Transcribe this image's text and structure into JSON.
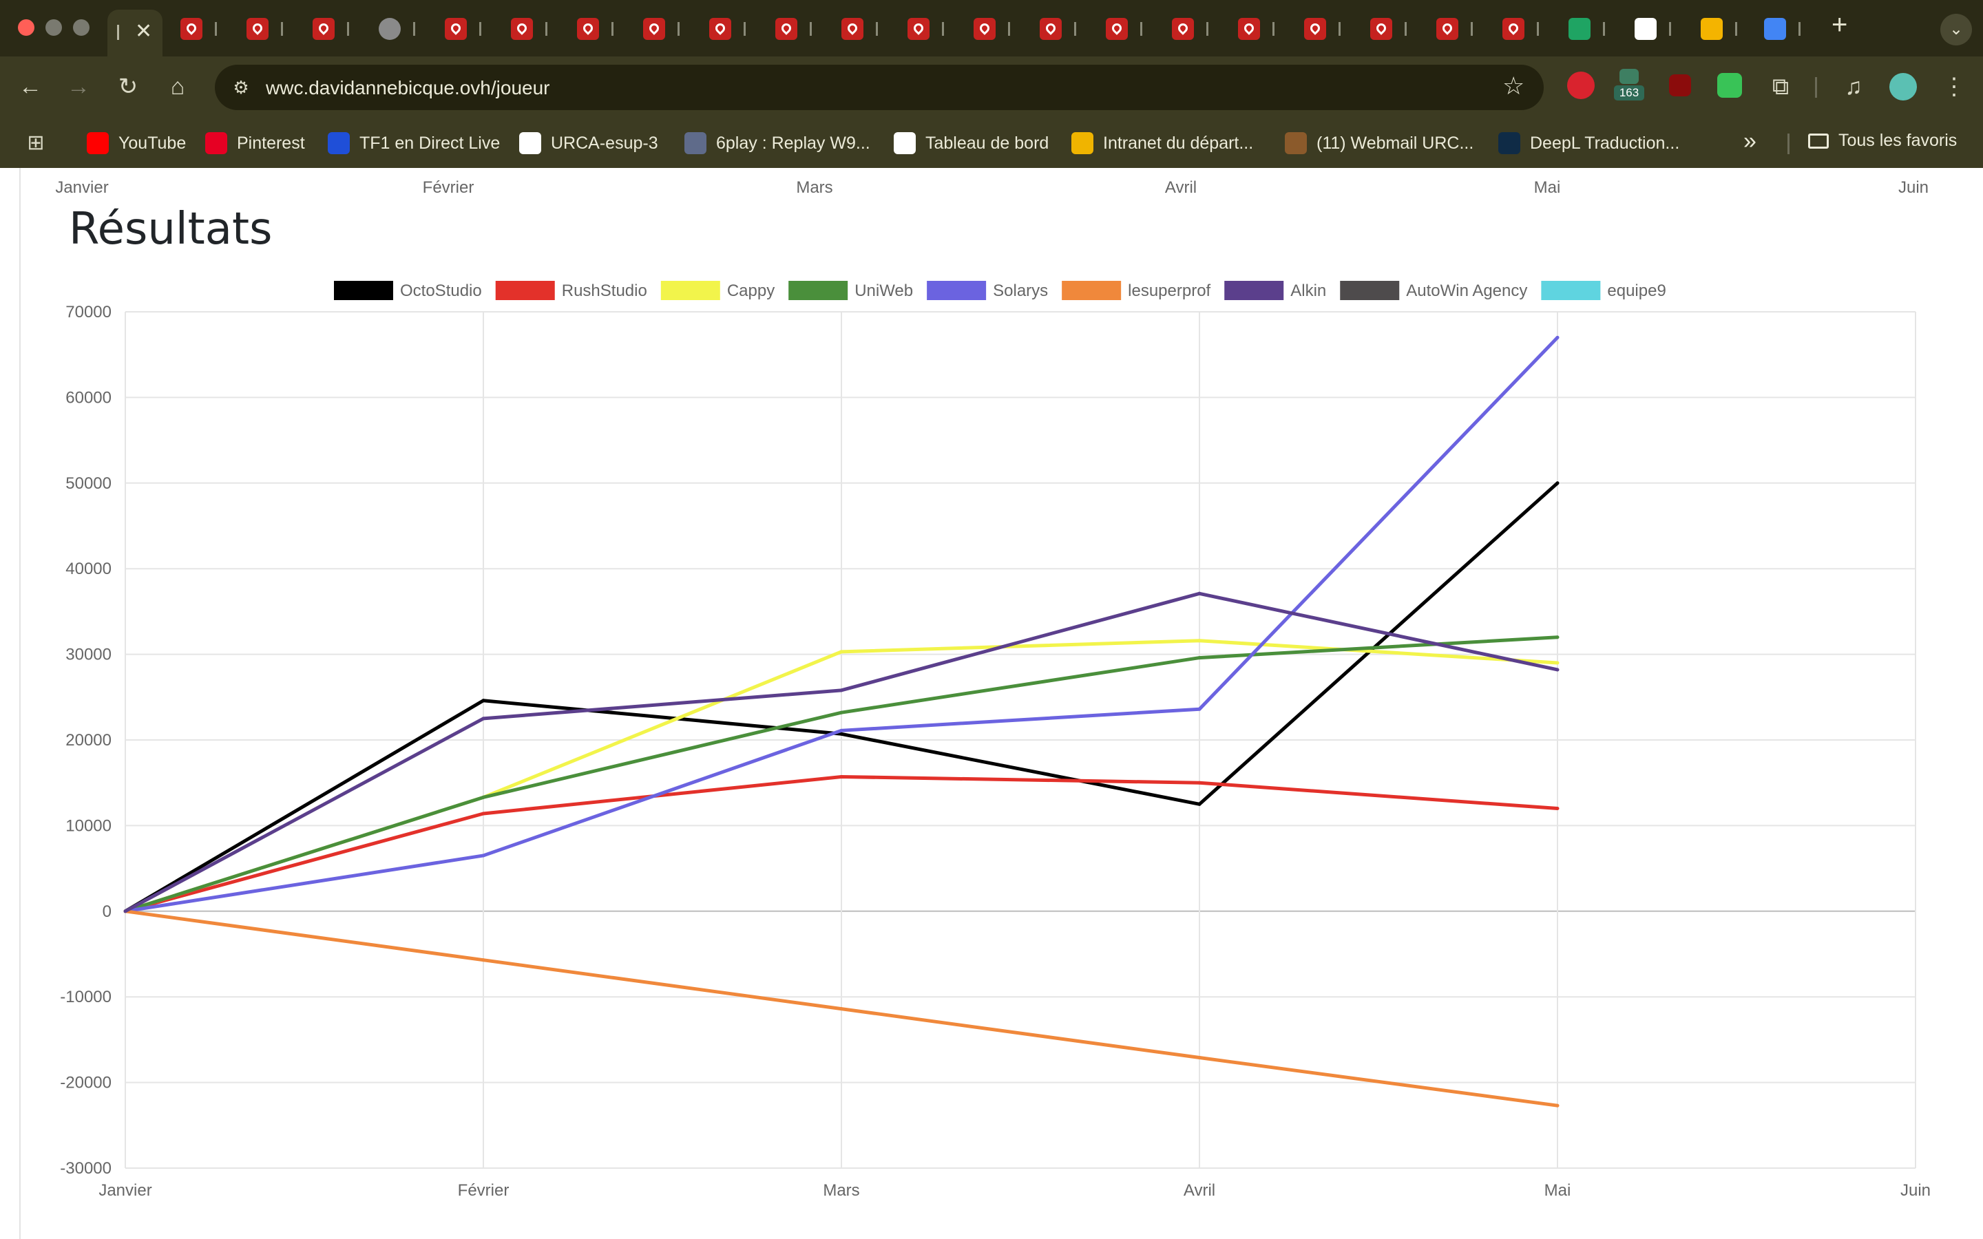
{
  "browser": {
    "url": "wwc.davidannebicque.ovh/joueur",
    "extension_badge": "163",
    "bookmarks": [
      {
        "label": "YouTube",
        "color": "#ff0000"
      },
      {
        "label": "Pinterest",
        "color": "#e60023"
      },
      {
        "label": "TF1 en Direct Live",
        "color": "#1f4fd8"
      },
      {
        "label": "URCA-esup-3",
        "color": "#ffffff"
      },
      {
        "label": "6play : Replay W9...",
        "color": "#5f6b8a"
      },
      {
        "label": "Tableau de bord",
        "color": "#ffffff"
      },
      {
        "label": "Intranet du départ...",
        "color": "#f0b400"
      },
      {
        "label": "(11) Webmail URC...",
        "color": "#8b5a2b"
      },
      {
        "label": "DeepL Traduction...",
        "color": "#0f2b46"
      }
    ],
    "all_bookmarks_label": "Tous les favoris",
    "overflow_label": "»"
  },
  "page": {
    "title": "Résultats",
    "top_axis_labels": [
      "Janvier",
      "Février",
      "Mars",
      "Avril",
      "Mai",
      "Juin"
    ]
  },
  "chart_data": {
    "type": "line",
    "title": "Résultats",
    "categories": [
      "Janvier",
      "Février",
      "Mars",
      "Avril",
      "Mai",
      "Juin"
    ],
    "ylim": [
      -30000,
      70000
    ],
    "yticks": [
      70000,
      60000,
      50000,
      40000,
      30000,
      20000,
      10000,
      0,
      -10000,
      -20000,
      -30000
    ],
    "grid": true,
    "legend_position": "top",
    "series": [
      {
        "name": "OctoStudio",
        "color": "#000000",
        "values": [
          0,
          24600,
          20700,
          12500,
          50000
        ]
      },
      {
        "name": "RushStudio",
        "color": "#e3312a",
        "values": [
          0,
          11400,
          15700,
          15000,
          12000
        ]
      },
      {
        "name": "Cappy",
        "color": "#f2f44b",
        "values": [
          0,
          13300,
          30300,
          31600,
          29000
        ]
      },
      {
        "name": "UniWeb",
        "color": "#4a8f3b",
        "values": [
          0,
          13300,
          23200,
          29600,
          32000
        ]
      },
      {
        "name": "Solarys",
        "color": "#6b63e0",
        "values": [
          0,
          6500,
          21100,
          23600,
          67000
        ]
      },
      {
        "name": "lesuperprof",
        "color": "#f0883b",
        "values": [
          0,
          -5700,
          -11400,
          -17100,
          -22700
        ]
      },
      {
        "name": "Alkin",
        "color": "#5b3f8c",
        "values": [
          0,
          22500,
          25800,
          37100,
          28200
        ]
      },
      {
        "name": "AutoWin Agency",
        "color": "#4e4b4c",
        "values": []
      },
      {
        "name": "equipe9",
        "color": "#5fd4e0",
        "values": []
      }
    ]
  }
}
